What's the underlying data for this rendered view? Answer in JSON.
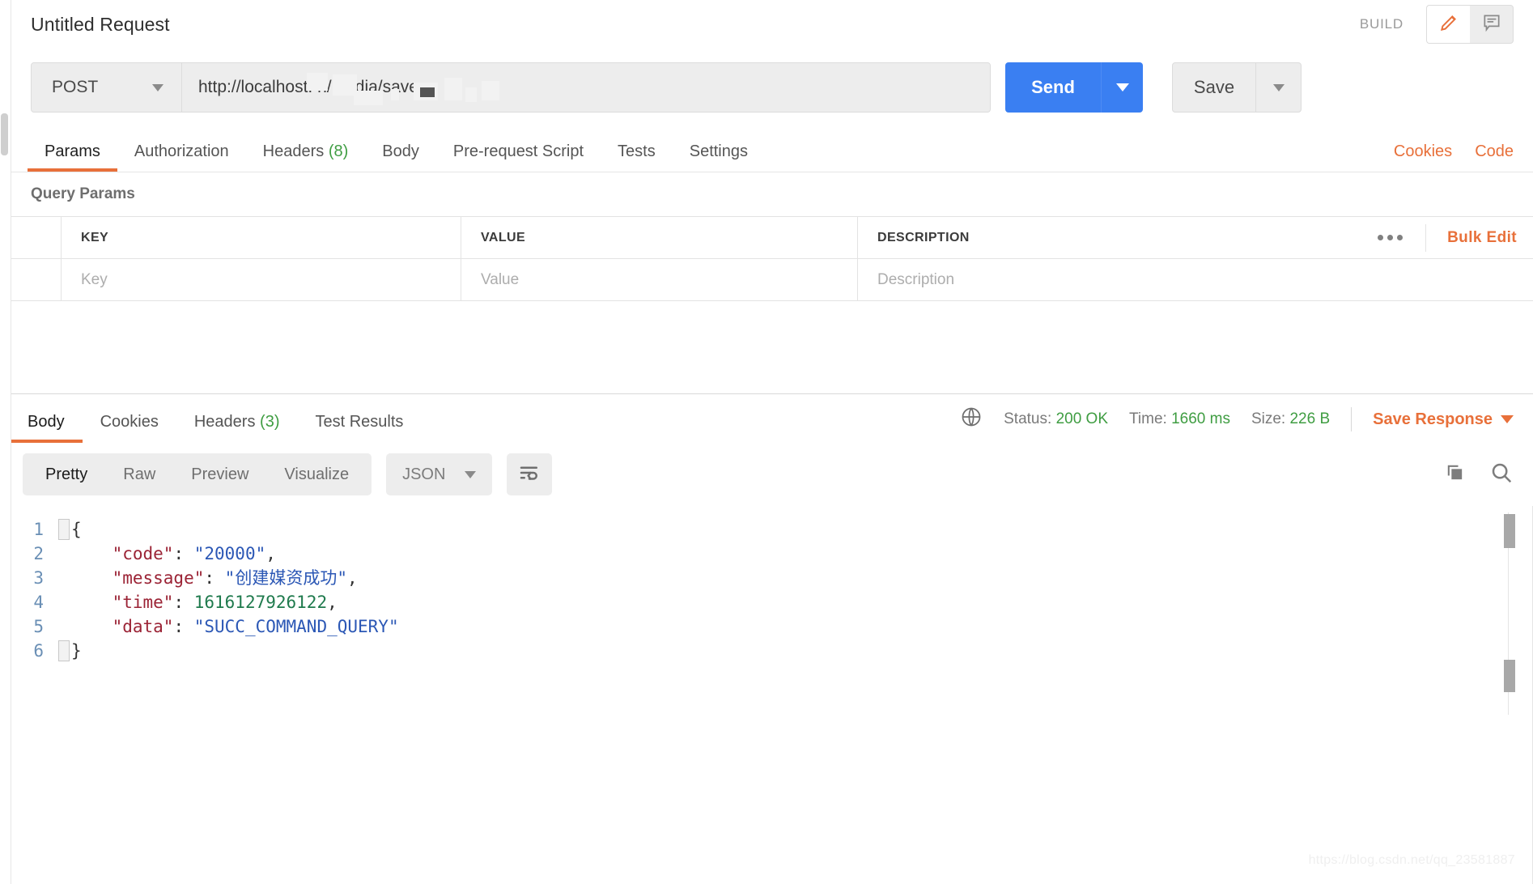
{
  "header": {
    "request_title": "Untitled Request",
    "build_label": "BUILD",
    "edit_icon": "pencil-icon",
    "comment_icon": "comment-icon"
  },
  "urlbar": {
    "method": "POST",
    "url": "http://localhost.                 n/media/save",
    "send_label": "Send",
    "save_label": "Save"
  },
  "request_tabs": {
    "items": [
      {
        "label": "Params",
        "count": "",
        "active": true
      },
      {
        "label": "Authorization",
        "count": "",
        "active": false
      },
      {
        "label": "Headers",
        "count": "(8)",
        "active": false
      },
      {
        "label": "Body",
        "count": "",
        "active": false
      },
      {
        "label": "Pre-request Script",
        "count": "",
        "active": false
      },
      {
        "label": "Tests",
        "count": "",
        "active": false
      },
      {
        "label": "Settings",
        "count": "",
        "active": false
      }
    ],
    "cookies_link": "Cookies",
    "code_link": "Code"
  },
  "query_params": {
    "section_title": "Query Params",
    "columns": [
      "KEY",
      "VALUE",
      "DESCRIPTION"
    ],
    "bulk_edit_label": "Bulk Edit",
    "more_icon": "ellipsis-icon",
    "placeholder_row": {
      "key": "Key",
      "value": "Value",
      "description": "Description"
    }
  },
  "response": {
    "tabs": [
      {
        "label": "Body",
        "count": "",
        "active": true
      },
      {
        "label": "Cookies",
        "count": "",
        "active": false
      },
      {
        "label": "Headers",
        "count": "(3)",
        "active": false
      },
      {
        "label": "Test Results",
        "count": "",
        "active": false
      }
    ],
    "globe_icon": "globe-icon",
    "status_label": "Status:",
    "status_value": "200 OK",
    "time_label": "Time:",
    "time_value": "1660 ms",
    "size_label": "Size:",
    "size_value": "226 B",
    "save_response_label": "Save Response"
  },
  "format_bar": {
    "views": [
      {
        "label": "Pretty",
        "active": true
      },
      {
        "label": "Raw",
        "active": false
      },
      {
        "label": "Preview",
        "active": false
      },
      {
        "label": "Visualize",
        "active": false
      }
    ],
    "language": "JSON",
    "wrap_icon": "word-wrap-icon",
    "copy_icon": "copy-icon",
    "search_icon": "search-icon"
  },
  "body_code": {
    "line_numbers": [
      "1",
      "2",
      "3",
      "4",
      "5",
      "6"
    ],
    "lines": [
      {
        "n": "1",
        "segments": [
          {
            "t": "{",
            "c": "punct"
          }
        ]
      },
      {
        "n": "2",
        "segments": [
          {
            "t": "    ",
            "c": "punct"
          },
          {
            "t": "\"code\"",
            "c": "key"
          },
          {
            "t": ": ",
            "c": "punct"
          },
          {
            "t": "\"20000\"",
            "c": "str"
          },
          {
            "t": ",",
            "c": "punct"
          }
        ]
      },
      {
        "n": "3",
        "segments": [
          {
            "t": "    ",
            "c": "punct"
          },
          {
            "t": "\"message\"",
            "c": "key"
          },
          {
            "t": ": ",
            "c": "punct"
          },
          {
            "t": "\"创建媒资成功\"",
            "c": "str"
          },
          {
            "t": ",",
            "c": "punct"
          }
        ]
      },
      {
        "n": "4",
        "segments": [
          {
            "t": "    ",
            "c": "punct"
          },
          {
            "t": "\"time\"",
            "c": "key"
          },
          {
            "t": ": ",
            "c": "punct"
          },
          {
            "t": "1616127926122",
            "c": "num"
          },
          {
            "t": ",",
            "c": "punct"
          }
        ]
      },
      {
        "n": "5",
        "segments": [
          {
            "t": "    ",
            "c": "punct"
          },
          {
            "t": "\"data\"",
            "c": "key"
          },
          {
            "t": ": ",
            "c": "punct"
          },
          {
            "t": "\"SUCC_COMMAND_QUERY\"",
            "c": "str"
          }
        ]
      },
      {
        "n": "6",
        "segments": [
          {
            "t": "}",
            "c": "punct"
          }
        ]
      }
    ]
  },
  "watermark": "https://blog.csdn.net/qq_23581887",
  "colors": {
    "accent_orange": "#e8703a",
    "send_blue": "#3a7ff2",
    "status_green": "#3f9d42"
  }
}
